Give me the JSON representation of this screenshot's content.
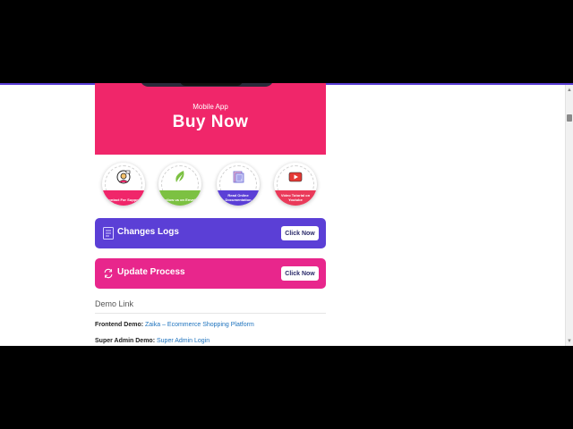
{
  "hero": {
    "subtitle": "Mobile App",
    "title": "Buy Now"
  },
  "features": [
    {
      "label": "Contact For Support",
      "color": "#f0266a",
      "icon": "support-agent-icon"
    },
    {
      "label": "Follow us on Envato",
      "color": "#7cc142",
      "icon": "envato-leaf-icon"
    },
    {
      "label": "Read Online Documentation",
      "color": "#5b3fd6",
      "icon": "documentation-icon"
    },
    {
      "label": "Video Tutorial on Youtube",
      "color": "#ea3a5a",
      "icon": "youtube-icon"
    }
  ],
  "changes_logs": {
    "label": "Changes Logs",
    "button": "Click Now",
    "color": "#5b3fd6",
    "icon": "document-list-icon"
  },
  "update_process": {
    "label": "Update Process",
    "button": "Click Now",
    "color": "#e8268c",
    "icon": "refresh-icon"
  },
  "demo": {
    "heading": "Demo Link",
    "frontend_label": "Frontend Demo:",
    "frontend_link": "Zaika – Ecommerce Shopping Platform",
    "admin_label": "Super Admin Demo:",
    "admin_link": "Super Admin Login"
  }
}
